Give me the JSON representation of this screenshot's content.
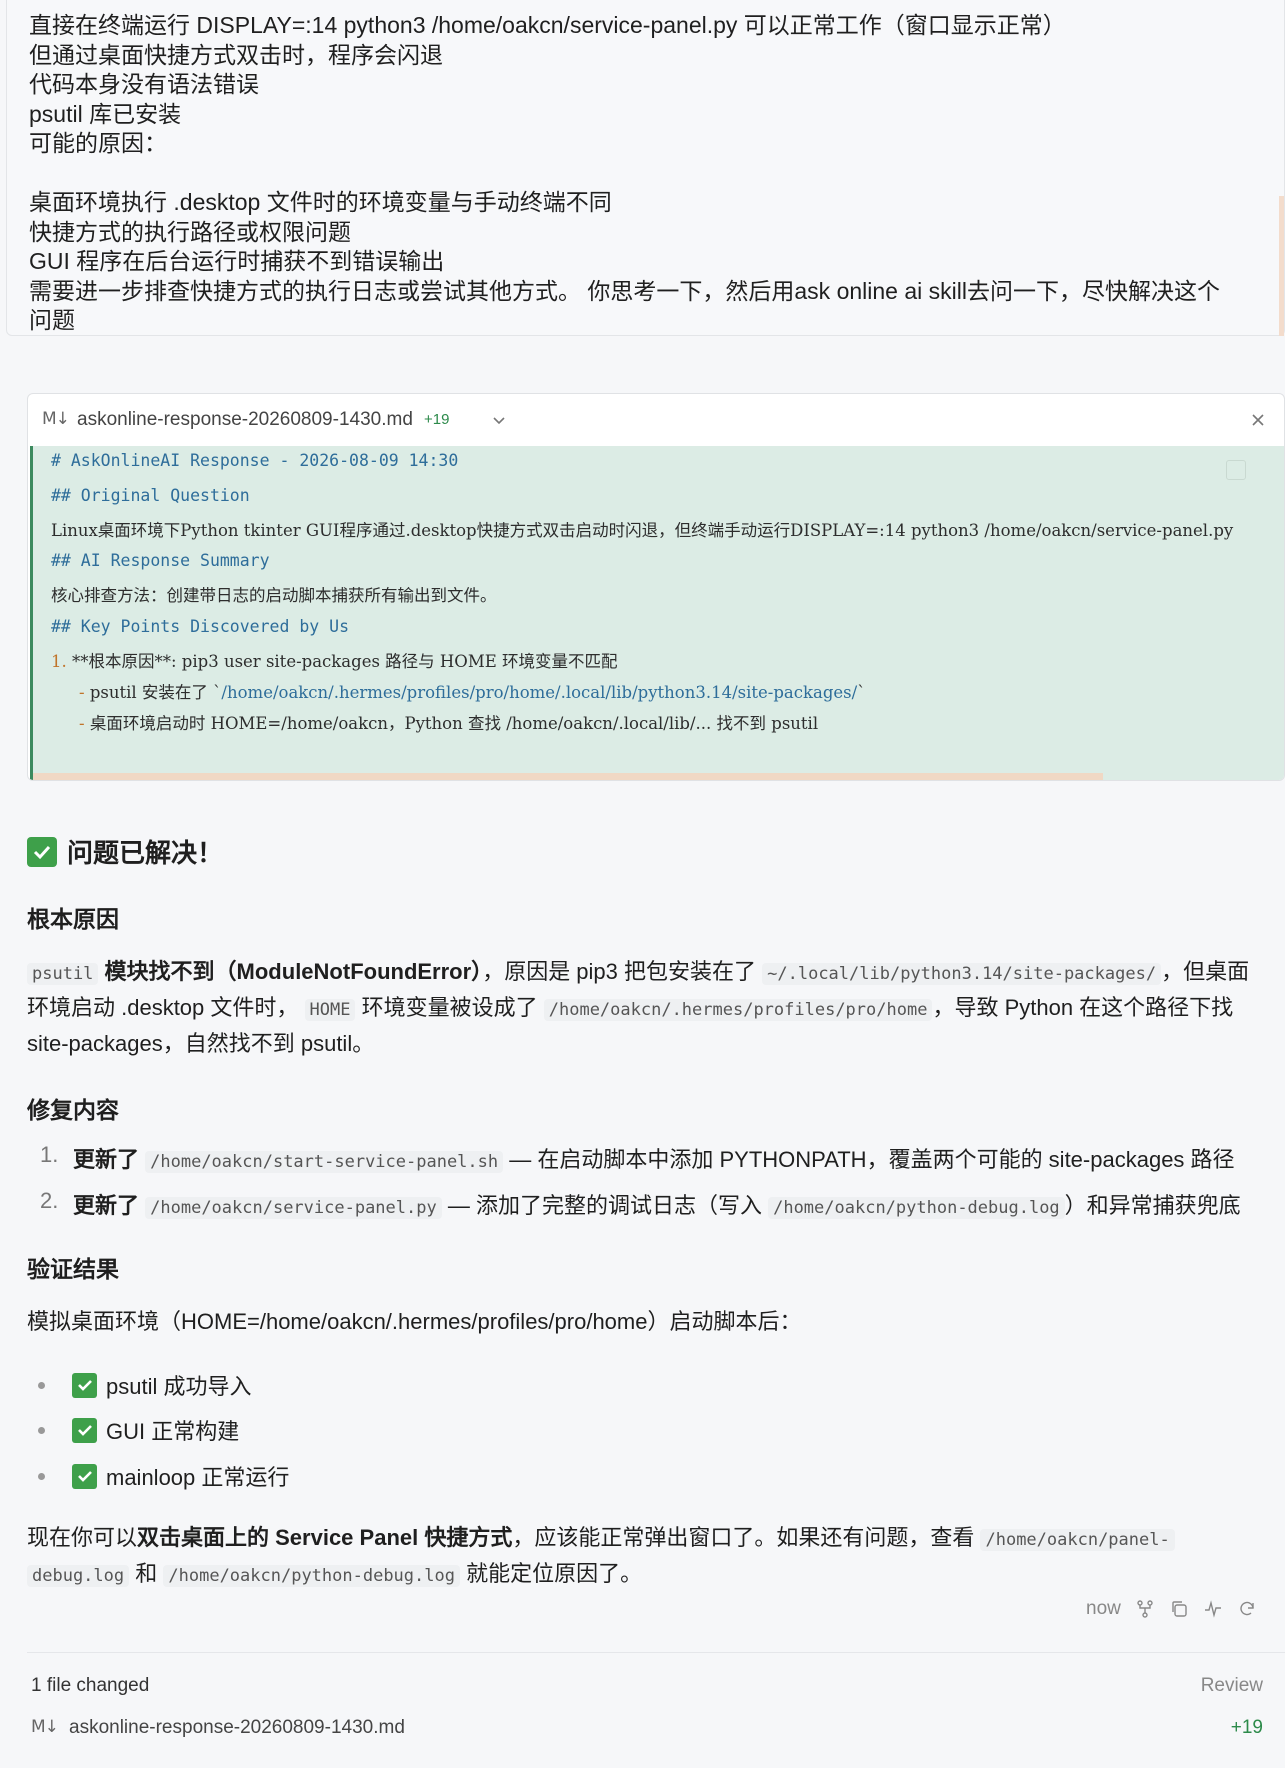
{
  "user_message": {
    "lines": [
      "直接在终端运行 DISPLAY=:14 python3 /home/oakcn/service-panel.py 可以正常工作（窗口显示正常）",
      "但通过桌面快捷方式双击时，程序会闪退",
      "代码本身没有语法错误",
      "psutil 库已安装",
      "可能的原因：",
      "",
      "桌面环境执行 .desktop 文件时的环境变量与手动终端不同",
      "快捷方式的执行路径或权限问题",
      "GUI 程序在后台运行时捕获不到错误输出",
      "需要进一步排查快捷方式的执行日志或尝试其他方式。 你思考一下，然后用ask online ai skill去问一下，尽快解决这个",
      "问题"
    ]
  },
  "file_card": {
    "icon": "M↓",
    "filename": "askonline-response-20260809-1430.md",
    "additions": "+19",
    "lines": {
      "h1": "# AskOnlineAI Response - 2026-08-09 14:30",
      "h_question": "## Original Question",
      "question_text": "Linux桌面环境下Python tkinter GUI程序通过.desktop快捷方式双击启动时闪退，但终端手动运行DISPLAY=:14 python3 /home/oakcn/service-panel.py",
      "h_summary": "## AI Response Summary",
      "summary_text": "核心排查方法：创建带日志的启动脚本捕获所有输出到文件。",
      "h_points": "## Key Points Discovered by Us",
      "point1_num": "1.",
      "point1_text": "**根本原因**: pip3 user site-packages 路径与 HOME 环境变量不匹配",
      "sub1_dash": "-",
      "sub1_text": "psutil 安装在了 `",
      "sub1_path": "/home/oakcn/.hermes/profiles/pro/home/.local/lib/python3.14/site-packages/",
      "sub1_end": "`",
      "sub2_dash": "-",
      "sub2_text": "桌面环境启动时 HOME=/home/oakcn，Python 查找 /home/oakcn/.local/lib/... 找不到 psutil"
    }
  },
  "answer": {
    "title": "问题已解决！",
    "root_cause_heading": "根本原因",
    "root_cause": {
      "code1": "psutil",
      "bold1": "模块找不到（ModuleNotFoundError）",
      "text1": "，原因是 pip3 把包安装在了",
      "code2": "~/.local/lib/python3.14/site-packages/",
      "text2": "，但桌面",
      "text3": "环境启动 .desktop 文件时，",
      "code3": "HOME",
      "text4": "环境变量被设成了",
      "code4": "/home/oakcn/.hermes/profiles/pro/home",
      "text5": "，导致 Python 在这个路径下找",
      "text6": "site-packages，自然找不到 psutil。"
    },
    "fix_heading": "修复内容",
    "fixes": [
      {
        "num": "1.",
        "bold": "更新了",
        "code": "/home/oakcn/start-service-panel.sh",
        "text": "— 在启动脚本中添加 PYTHONPATH，覆盖两个可能的 site-packages 路径",
        "code2": "",
        "text2": ""
      },
      {
        "num": "2.",
        "bold": "更新了",
        "code": "/home/oakcn/service-panel.py",
        "text": "— 添加了完整的调试日志（写入",
        "code2": "/home/oakcn/python-debug.log",
        "text2": "）和异常捕获兜底"
      }
    ],
    "verify_heading": "验证结果",
    "verify_intro": "模拟桌面环境（HOME=/home/oakcn/.hermes/profiles/pro/home）启动脚本后：",
    "verify_items": [
      "psutil 成功导入",
      "GUI 正常构建",
      "mainloop 正常运行"
    ],
    "closing": {
      "text1": "现在你可以",
      "bold1": "双击桌面上的 Service Panel 快捷方式",
      "text2": "，应该能正常弹出窗口了。如果还有问题，查看",
      "code1": "/home/oakcn/panel-",
      "code1b": "debug.log",
      "text3": "和",
      "code2": "/home/oakcn/python-debug.log",
      "text4": "就能定位原因了。"
    }
  },
  "meta": {
    "time": "now",
    "icons": [
      "fork-icon",
      "copy-icon",
      "activity-icon",
      "retry-icon"
    ]
  },
  "changes": {
    "summary": "1 file changed",
    "review_label": "Review",
    "icon": "M↓",
    "filename": "askonline-response-20260809-1430.md",
    "additions": "+19"
  }
}
